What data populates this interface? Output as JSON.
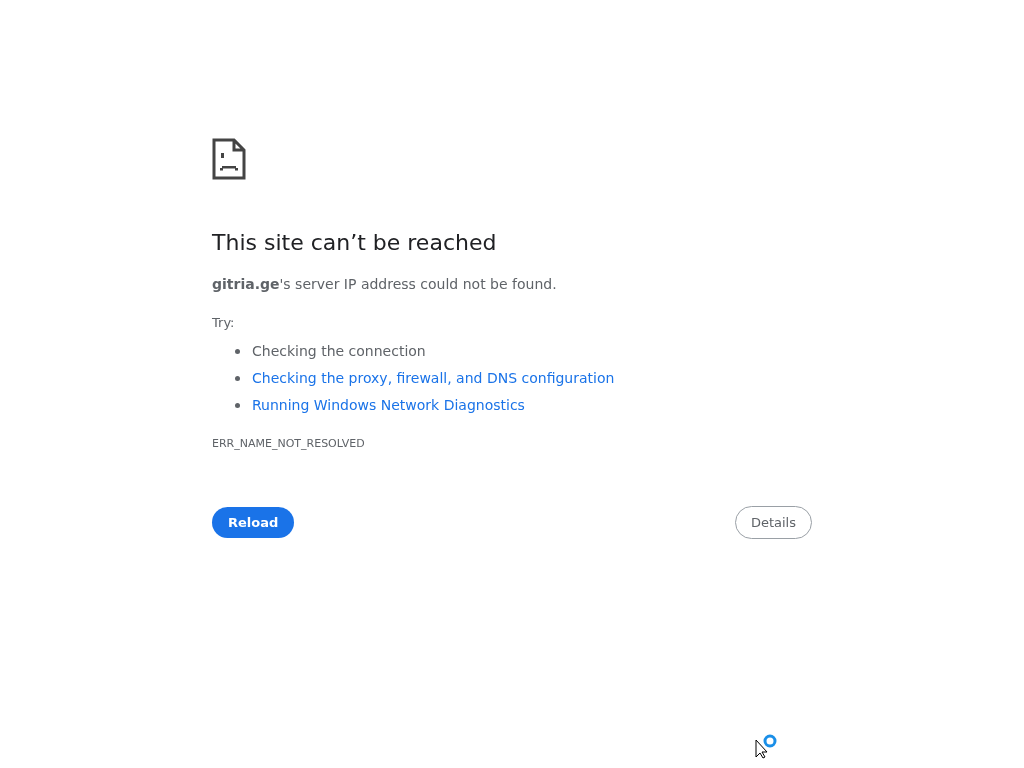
{
  "heading": "This site can’t be reached",
  "message": "**gitria.ge**'s server IP address could not be found.",
  "try_label": "Try:",
  "suggestions": [
    {
      "text": "Checking the connection",
      "kind": "text"
    },
    {
      "text": "Checking the proxy, firewall, and DNS configuration",
      "kind": "link"
    },
    {
      "text": "Running Windows Network Diagnostics",
      "kind": "link"
    }
  ],
  "error_code": "ERR_NAME_NOT_RESOLVED",
  "buttons": [
    {
      "label": "Reload",
      "kind": "primary"
    },
    {
      "label": "Details",
      "kind": "secondary"
    }
  ]
}
